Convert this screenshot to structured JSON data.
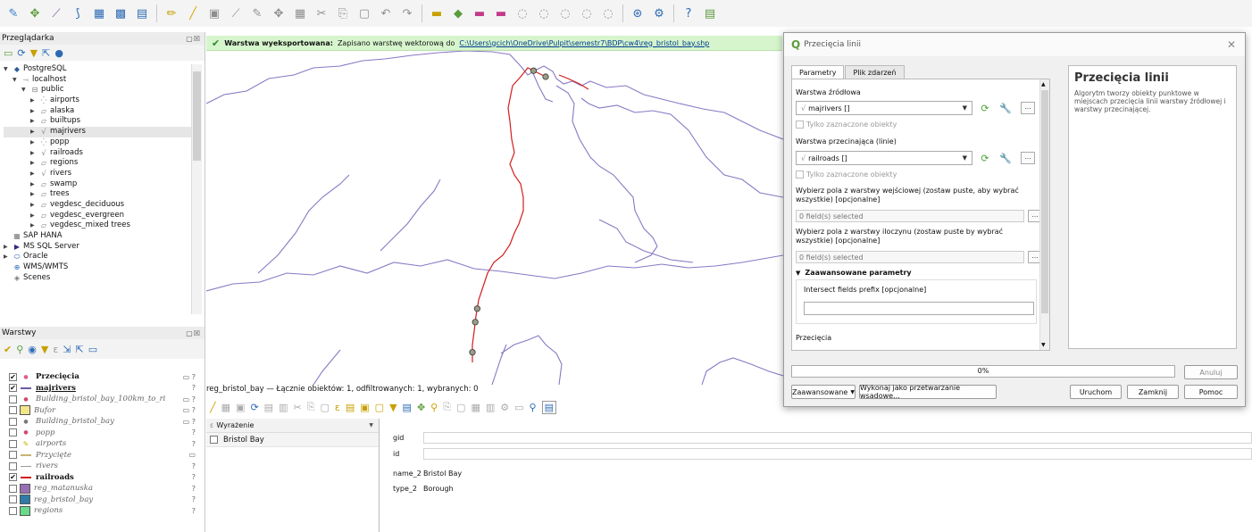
{
  "browser": {
    "title": "Przeglądarka",
    "tree": [
      {
        "label": "PostgreSQL",
        "indent": 0,
        "arrow": "▼",
        "icon": "postgres-icon"
      },
      {
        "label": "localhost",
        "indent": 1,
        "arrow": "▼",
        "icon": "server-icon"
      },
      {
        "label": "public",
        "indent": 2,
        "arrow": "▼",
        "icon": "schema-icon"
      },
      {
        "label": "airports",
        "indent": 3,
        "arrow": "▶",
        "icon": "point-layer-icon"
      },
      {
        "label": "alaska",
        "indent": 3,
        "arrow": "▶",
        "icon": "polygon-layer-icon"
      },
      {
        "label": "builtups",
        "indent": 3,
        "arrow": "▶",
        "icon": "polygon-layer-icon"
      },
      {
        "label": "majrivers",
        "indent": 3,
        "arrow": "▶",
        "icon": "line-layer-icon",
        "selected": true
      },
      {
        "label": "popp",
        "indent": 3,
        "arrow": "▶",
        "icon": "point-layer-icon"
      },
      {
        "label": "railroads",
        "indent": 3,
        "arrow": "▶",
        "icon": "line-layer-icon"
      },
      {
        "label": "regions",
        "indent": 3,
        "arrow": "▶",
        "icon": "polygon-layer-icon"
      },
      {
        "label": "rivers",
        "indent": 3,
        "arrow": "▶",
        "icon": "line-layer-icon"
      },
      {
        "label": "swamp",
        "indent": 3,
        "arrow": "▶",
        "icon": "polygon-layer-icon"
      },
      {
        "label": "trees",
        "indent": 3,
        "arrow": "▶",
        "icon": "polygon-layer-icon"
      },
      {
        "label": "vegdesc_deciduous",
        "indent": 3,
        "arrow": "▶",
        "icon": "polygon-layer-icon"
      },
      {
        "label": "vegdesc_evergreen",
        "indent": 3,
        "arrow": "▶",
        "icon": "polygon-layer-icon"
      },
      {
        "label": "vegdesc_mixed trees",
        "indent": 3,
        "arrow": "▶",
        "icon": "polygon-layer-icon"
      },
      {
        "label": "SAP HANA",
        "indent": 0,
        "arrow": "",
        "icon": "sap-hana-icon"
      },
      {
        "label": "MS SQL Server",
        "indent": 0,
        "arrow": "▶",
        "icon": "mssql-icon"
      },
      {
        "label": "Oracle",
        "indent": 0,
        "arrow": "▶",
        "icon": "oracle-icon"
      },
      {
        "label": "WMS/WMTS",
        "indent": 0,
        "arrow": "",
        "icon": "wms-icon"
      },
      {
        "label": "Scenes",
        "indent": 0,
        "arrow": "",
        "icon": "scenes-icon"
      }
    ]
  },
  "layers": {
    "title": "Warstwy",
    "items": [
      {
        "label": "Przecięcia",
        "checked": true,
        "style": "b",
        "symbol": "point",
        "color": "#e05a8a",
        "stat": "▭ ?"
      },
      {
        "label": "majrivers",
        "checked": true,
        "style": "b u",
        "symbol": "line",
        "color": "#6c5ba0",
        "stat": "?"
      },
      {
        "label": "Building_bristol_bay_100km_to_ri",
        "checked": false,
        "style": "it",
        "symbol": "point",
        "color": "#d04a6a",
        "stat": "▭ ?"
      },
      {
        "label": "Bufor",
        "checked": false,
        "style": "it",
        "symbol": "fill",
        "color": "#f2e58a",
        "stat": "▭ ?"
      },
      {
        "label": "Building_bristol_bay",
        "checked": false,
        "style": "it",
        "symbol": "point",
        "color": "#777777",
        "stat": "▭ ?"
      },
      {
        "label": "popp",
        "checked": false,
        "style": "it",
        "symbol": "point",
        "color": "#d04a6a",
        "stat": "?"
      },
      {
        "label": "airports",
        "checked": false,
        "style": "it",
        "symbol": "pen",
        "color": "#c8b400",
        "stat": "?"
      },
      {
        "label": "Przycięte",
        "checked": false,
        "style": "it",
        "symbol": "line",
        "color": "#c8b470",
        "stat": "▭"
      },
      {
        "label": "rivers",
        "checked": false,
        "style": "it",
        "symbol": "line",
        "color": "#999999",
        "stat": "?"
      },
      {
        "label": "railroads",
        "checked": true,
        "style": "b",
        "symbol": "line",
        "color": "#d11a1a",
        "stat": "?"
      },
      {
        "label": "reg_matanuska",
        "checked": false,
        "style": "it",
        "symbol": "fill",
        "color": "#9b6fb5",
        "stat": "?"
      },
      {
        "label": "reg_bristol_bay",
        "checked": false,
        "style": "it",
        "symbol": "fill",
        "color": "#2f7aa8",
        "stat": "?"
      },
      {
        "label": "regions",
        "checked": false,
        "style": "it",
        "symbol": "fill",
        "color": "#69d98a",
        "stat": "?"
      }
    ]
  },
  "message": {
    "bold": "Warstwa wyeksportowana:",
    "text": "Zapisano warstwę wektorową do",
    "link": "C:\\Users\\gcich\\OneDrive\\Pulpit\\semestr7\\BDP\\cw4\\reg_bristol_bay.shp"
  },
  "attribute": {
    "title": "reg_bristol_bay — Łącznie obiektów: 1, odfiltrowanych: 1, wybranych: 0",
    "expr_header": "Wyrażenie",
    "features": [
      "Bristol Bay"
    ],
    "fields": [
      {
        "name": "gid",
        "value": ""
      },
      {
        "name": "id",
        "value": ""
      },
      {
        "name": "name_2",
        "value": "Bristol Bay"
      },
      {
        "name": "type_2",
        "value": "Borough"
      }
    ]
  },
  "dialog": {
    "title": "Przecięcia linii",
    "tabs": [
      "Parametry",
      "Plik zdarzeń"
    ],
    "source_label": "Warstwa źródłowa",
    "source_value": "majrivers []",
    "selected_only": "Tylko zaznaczone obiekty",
    "intersect_label": "Warstwa przecinająca (linie)",
    "intersect_value": "railroads []",
    "input_fields_label": "Wybierz pola z warstwy wejściowej (zostaw puste, aby wybrać wszystkie) [opcjonalne]",
    "input_fields_value": "0 field(s) selected",
    "overlay_fields_label": "Wybierz pola z warstwy iloczynu (zostaw puste by wybrać wszystkie) [opcjonalne]",
    "overlay_fields_value": "0 field(s) selected",
    "advanced": "Zaawansowane parametry",
    "prefix_label": "Intersect fields prefix [opcjonalne]",
    "output_label": "Przecięcia",
    "help_title": "Przecięcia linii",
    "help_text": "Algorytm tworzy obiekty punktowe w miejscach przecięcia linii warstwy źródłowej i warstwy przecinającej.",
    "progress": "0%",
    "progress_value": 0,
    "buttons": {
      "cancel": "Anuluj",
      "advanced": "Zaawansowane",
      "batch": "Wykonaj jako przetwarzanie wsadowe...",
      "run": "Uruchom",
      "close": "Zamknij",
      "help": "Pomoc"
    }
  },
  "colors": {
    "river": "#8a78c4",
    "railroad": "#d31d1d",
    "node": "#9c9c88",
    "accent": "#2a8a2a"
  }
}
